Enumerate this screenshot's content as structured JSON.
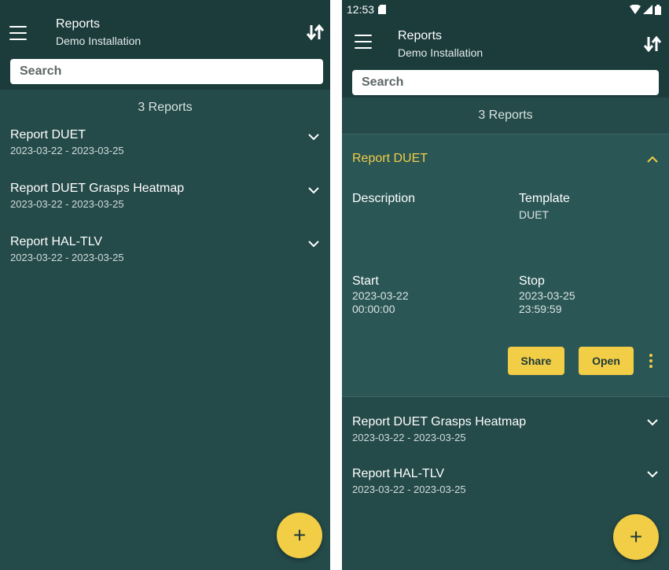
{
  "left": {
    "title": "Reports",
    "subtitle": "Demo Installation",
    "search_placeholder": "Search",
    "count": "3 Reports",
    "reports": [
      {
        "name": "Report DUET",
        "dates": "2023-03-22 - 2023-03-25"
      },
      {
        "name": "Report DUET Grasps Heatmap",
        "dates": "2023-03-22 - 2023-03-25"
      },
      {
        "name": "Report HAL-TLV",
        "dates": "2023-03-22 - 2023-03-25"
      }
    ],
    "fab_label": "+"
  },
  "right": {
    "status_time": "12:53",
    "title": "Reports",
    "subtitle": "Demo Installation",
    "search_placeholder": "Search",
    "count": "3 Reports",
    "expanded": {
      "name": "Report DUET",
      "description_label": "Description",
      "template_label": "Template",
      "template_value": "DUET",
      "start_label": "Start",
      "start_date": "2023-03-22",
      "start_time": "00:00:00",
      "stop_label": "Stop",
      "stop_date": "2023-03-25",
      "stop_time": "23:59:59",
      "share_label": "Share",
      "open_label": "Open"
    },
    "reports": [
      {
        "name": "Report DUET Grasps Heatmap",
        "dates": "2023-03-22 - 2023-03-25"
      },
      {
        "name": "Report HAL-TLV",
        "dates": "2023-03-22 - 2023-03-25"
      }
    ],
    "fab_label": "+"
  },
  "colors": {
    "appbar": "#1c3b3b",
    "background": "#244a49",
    "expanded_background": "#2a5655",
    "accent": "#f2cd46"
  }
}
